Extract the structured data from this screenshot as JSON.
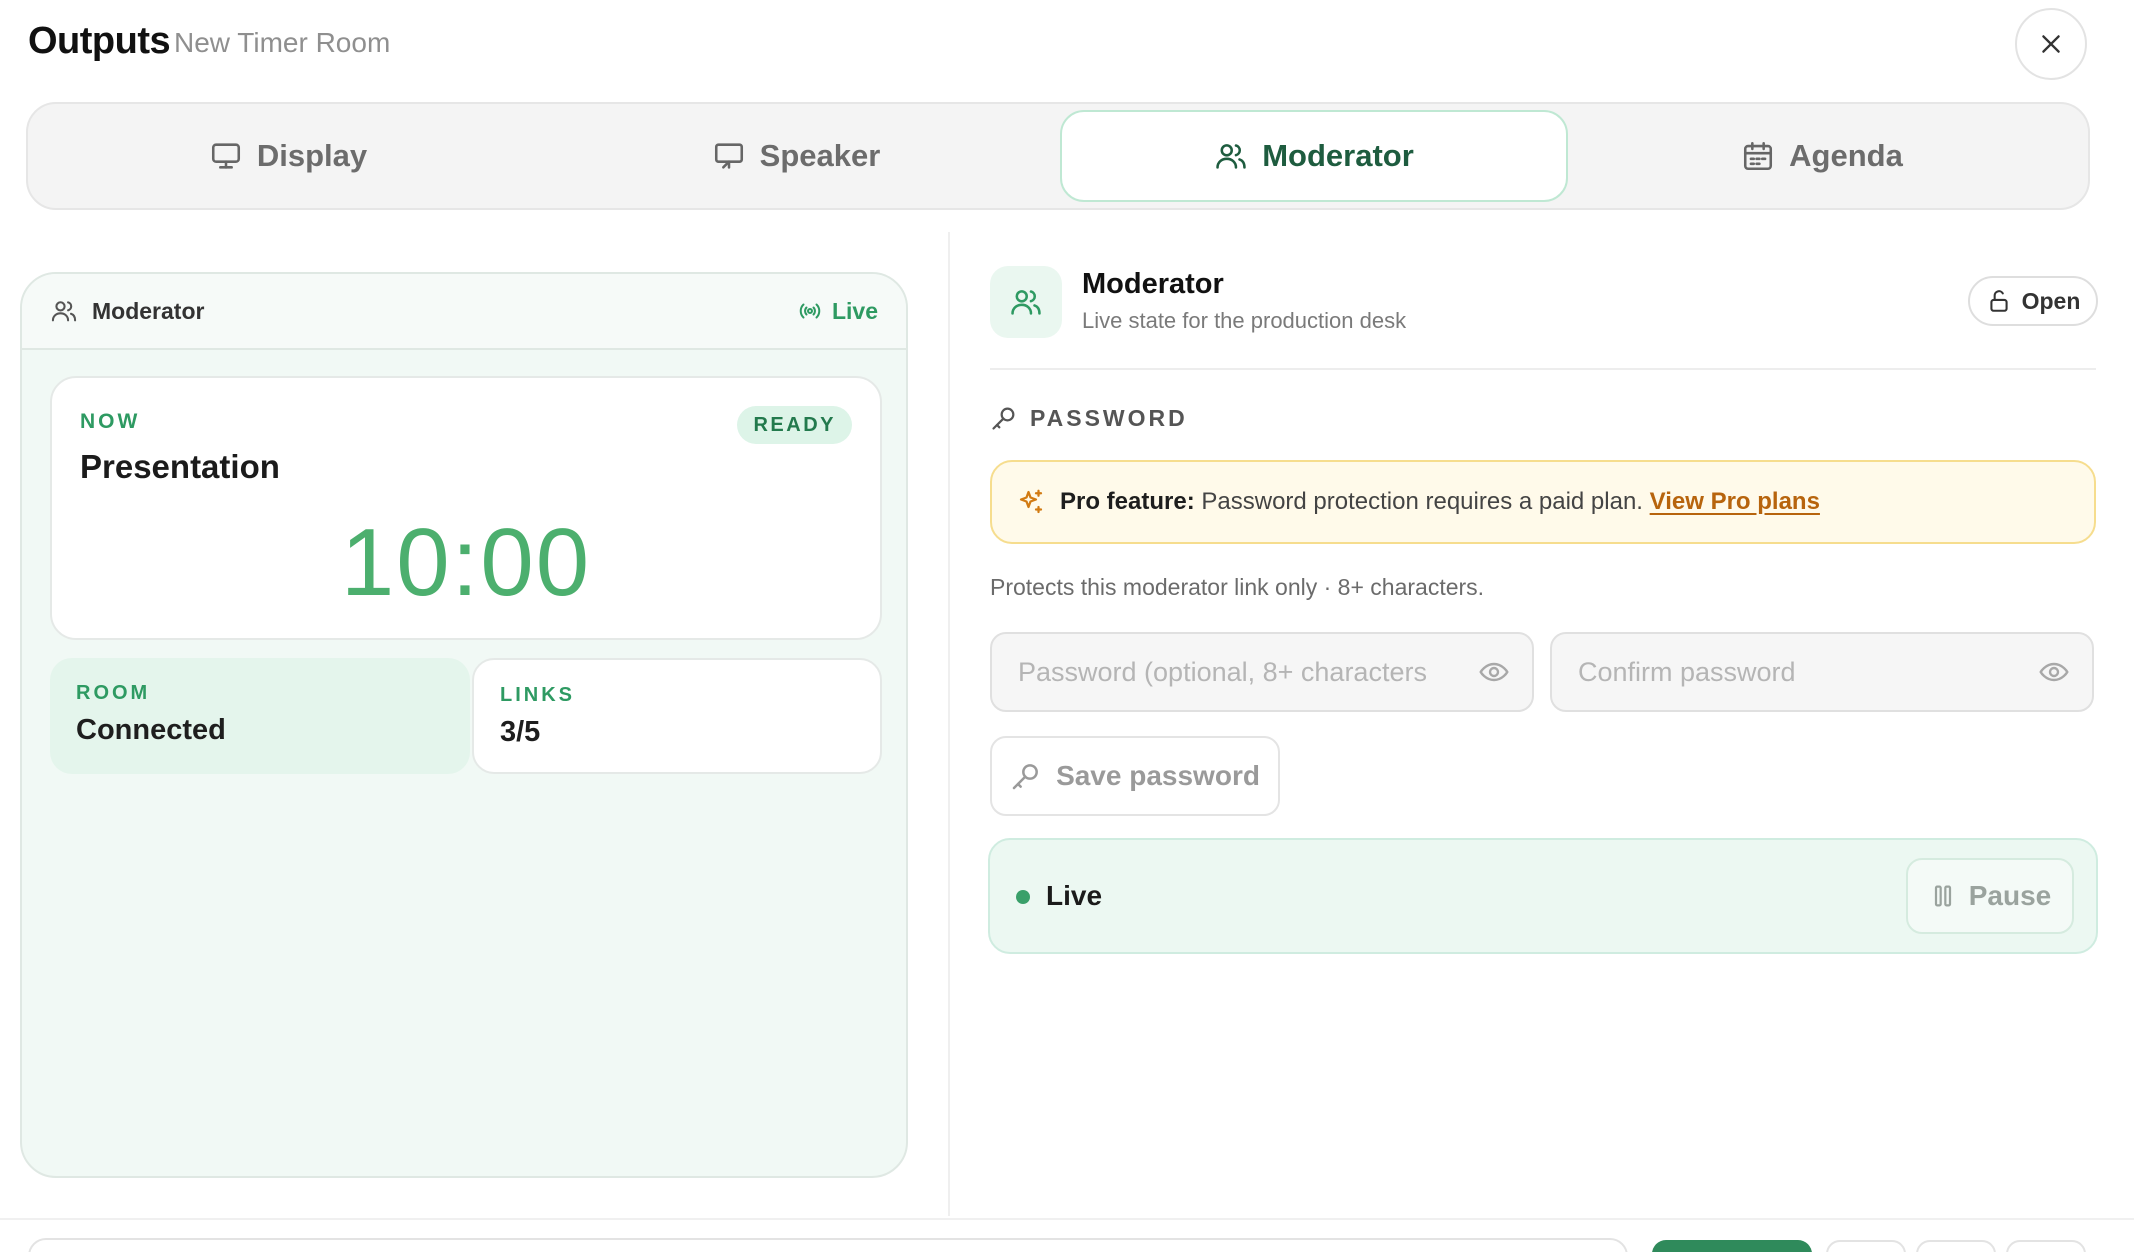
{
  "header": {
    "title": "Outputs",
    "subtitle": "New Timer Room"
  },
  "tabs": [
    {
      "label": "Display",
      "icon": "monitor-icon",
      "active": false
    },
    {
      "label": "Speaker",
      "icon": "presentation-icon",
      "active": false
    },
    {
      "label": "Moderator",
      "icon": "users-icon",
      "active": true
    },
    {
      "label": "Agenda",
      "icon": "calendar-icon",
      "active": false
    }
  ],
  "preview": {
    "header_label": "Moderator",
    "live_label": "Live",
    "now": {
      "label": "NOW",
      "badge": "READY",
      "title": "Presentation",
      "timer": "10:00"
    },
    "room": {
      "label": "ROOM",
      "value": "Connected"
    },
    "links": {
      "label": "LINKS",
      "value": "3/5"
    }
  },
  "panel": {
    "title": "Moderator",
    "subtitle": "Live state for the production desk",
    "open_label": "Open"
  },
  "password": {
    "heading": "PASSWORD",
    "pro_strong": "Pro feature:",
    "pro_text": "Password protection requires a paid plan.",
    "pro_link": "View Pro plans",
    "help": "Protects this moderator link only · 8+ characters.",
    "field1_placeholder": "Password (optional, 8+ characters",
    "field2_placeholder": "Confirm password",
    "save_label": "Save password"
  },
  "live_status": {
    "label": "Live",
    "pause_label": "Pause"
  },
  "colors": {
    "accent": "#2e9a62",
    "timer": "#4caf6e",
    "pro_link": "#b7640d"
  }
}
